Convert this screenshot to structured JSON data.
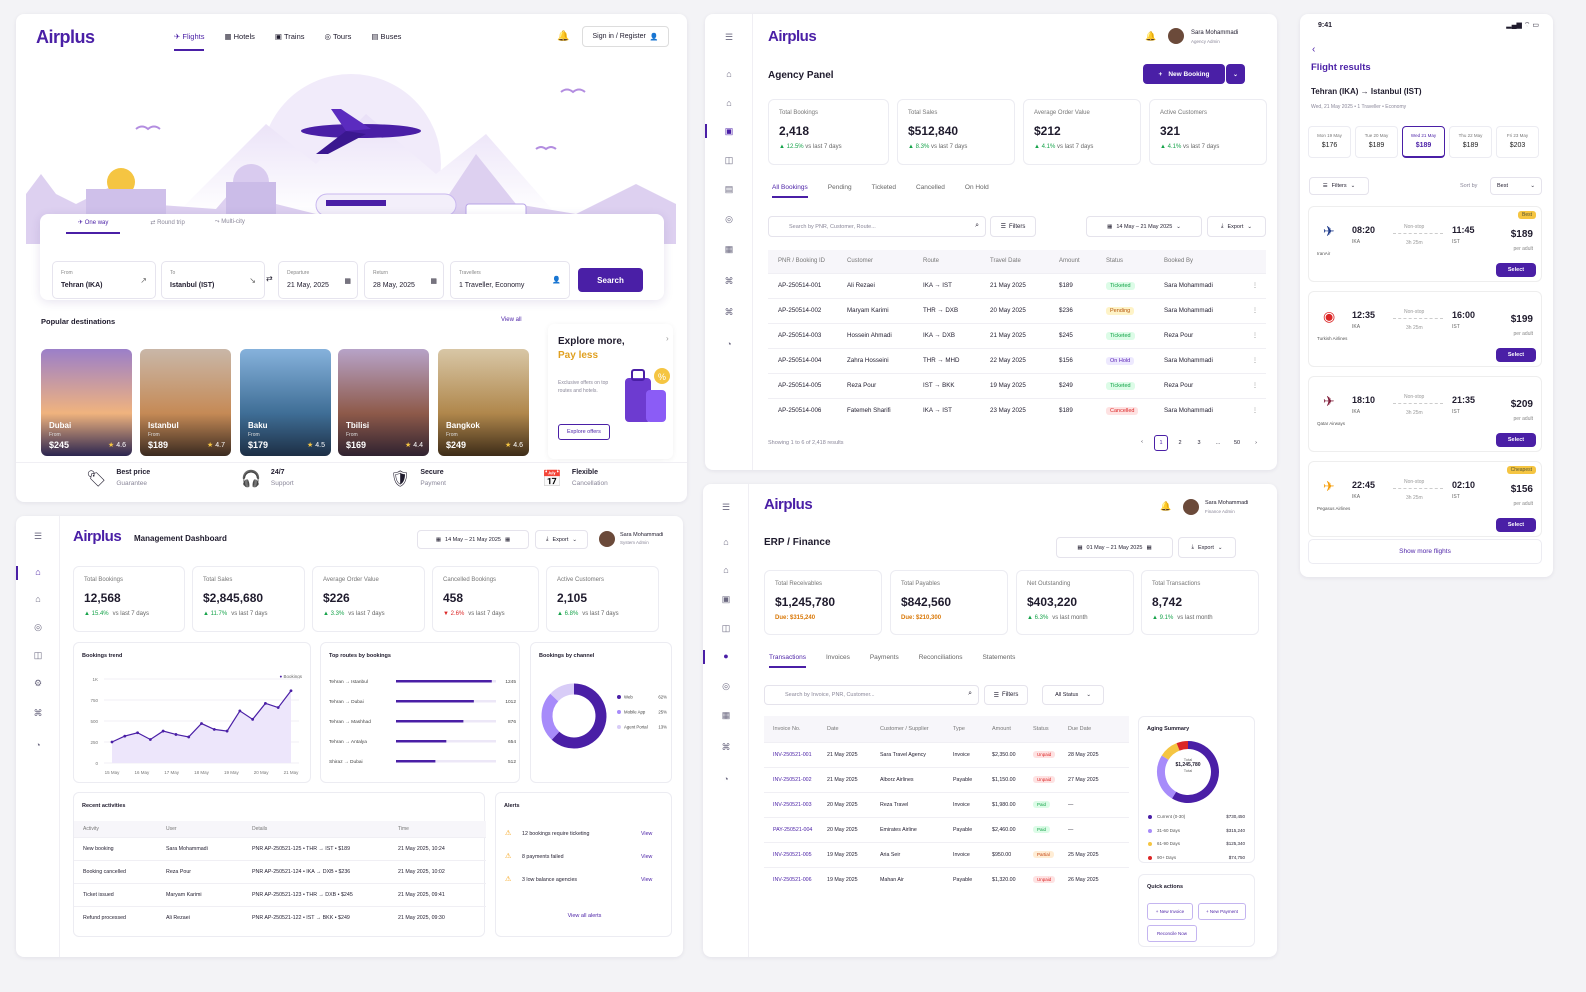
{
  "booking": {
    "logo": "Airplus",
    "nav": [
      "Flights",
      "Hotels",
      "Trains",
      "Tours",
      "Buses"
    ],
    "signin": "Sign in / Register",
    "trip_types": [
      "One way",
      "Round trip",
      "Multi-city"
    ],
    "from_label": "From",
    "from": "Tehran (IKA)",
    "to_label": "To",
    "to": "Istanbul (IST)",
    "dep_label": "Departure",
    "dep": "21 May, 2025",
    "ret_label": "Return",
    "ret": "28 May, 2025",
    "trav_label": "Travellers",
    "trav": "1 Traveller, Economy",
    "search": "Search",
    "popular": "Popular destinations",
    "view_all": "View all",
    "destinations": [
      {
        "name": "Dubai",
        "from": "From",
        "price": "$245",
        "rating": "4.6"
      },
      {
        "name": "Istanbul",
        "from": "From",
        "price": "$189",
        "rating": "4.7"
      },
      {
        "name": "Baku",
        "from": "From",
        "price": "$179",
        "rating": "4.5"
      },
      {
        "name": "Tbilisi",
        "from": "From",
        "price": "$169",
        "rating": "4.4"
      },
      {
        "name": "Bangkok",
        "from": "From",
        "price": "$249",
        "rating": "4.6"
      }
    ],
    "promo_title": "Explore more,",
    "promo_title2": "Pay less",
    "promo_text": "Exclusive offers on top routes and hotels.",
    "promo_btn": "Explore offers",
    "features": [
      {
        "t": "Best price",
        "s": "Guarantee"
      },
      {
        "t": "24/7",
        "s": "Support"
      },
      {
        "t": "Secure",
        "s": "Payment"
      },
      {
        "t": "Flexible",
        "s": "Cancellation"
      }
    ]
  },
  "agency": {
    "logo": "Airplus",
    "user": "Sara Mohammadi",
    "role": "Agency Admin",
    "title": "Agency Panel",
    "new_booking": "New Booking",
    "kpis": [
      {
        "l": "Total Bookings",
        "v": "2,418",
        "d": "12.5%",
        "s": "vs last 7 days"
      },
      {
        "l": "Total Sales",
        "v": "$512,840",
        "d": "8.3%",
        "s": "vs last 7 days"
      },
      {
        "l": "Average Order Value",
        "v": "$212",
        "d": "4.1%",
        "s": "vs last 7 days"
      },
      {
        "l": "Active Customers",
        "v": "321",
        "d": "4.1%",
        "s": "vs last 7 days"
      }
    ],
    "tabs": [
      "All Bookings",
      "Pending",
      "Ticketed",
      "Cancelled",
      "On Hold"
    ],
    "search_ph": "Search by PNR, Customer, Route...",
    "filters": "Filters",
    "date_range": "14 May – 21 May 2025",
    "export": "Export",
    "cols": [
      "PNR / Booking ID",
      "Customer",
      "Route",
      "Travel Date",
      "Amount",
      "Status",
      "Booked By"
    ],
    "rows": [
      [
        "AP-250514-001",
        "Ali Rezaei",
        "IKA → IST",
        "21 May 2025",
        "$189",
        "Ticketed",
        "Sara Mohammadi"
      ],
      [
        "AP-250514-002",
        "Maryam Karimi",
        "THR → DXB",
        "20 May 2025",
        "$236",
        "Pending",
        "Sara Mohammadi"
      ],
      [
        "AP-250514-003",
        "Hossein Ahmadi",
        "IKA → DXB",
        "21 May 2025",
        "$245",
        "Ticketed",
        "Reza Pour"
      ],
      [
        "AP-250514-004",
        "Zahra Hosseini",
        "THR → MHD",
        "22 May 2025",
        "$156",
        "On Hold",
        "Sara Mohammadi"
      ],
      [
        "AP-250514-005",
        "Reza Pour",
        "IST → BKK",
        "19 May 2025",
        "$249",
        "Ticketed",
        "Reza Pour"
      ],
      [
        "AP-250514-006",
        "Fatemeh Sharifi",
        "IKA → IST",
        "23 May 2025",
        "$189",
        "Cancelled",
        "Sara Mohammadi"
      ]
    ],
    "showing": "Showing 1 to 6 of 2,418 results",
    "pages": [
      "1",
      "2",
      "3",
      "...",
      "50"
    ]
  },
  "mobile": {
    "time": "9:41",
    "title": "Flight results",
    "from": "Tehran (IKA)",
    "to": "Istanbul (IST)",
    "sub": "Wed, 21 May 2025  •  1 Traveller  •  Economy",
    "dates": [
      {
        "d": "Mon 19 May",
        "p": "$176"
      },
      {
        "d": "Tue 20 May",
        "p": "$189"
      },
      {
        "d": "Wed 21 May",
        "p": "$189"
      },
      {
        "d": "Thu 22 May",
        "p": "$189"
      },
      {
        "d": "Fri 23 May",
        "p": "$203"
      }
    ],
    "filters": "Filters",
    "sort_label": "Sort by",
    "sort": "Best",
    "flights": [
      {
        "airline": "IranAir",
        "dep": "08:20",
        "arr": "11:45",
        "from": "IKA",
        "to": "IST",
        "stop": "Non-stop",
        "dur": "3h 25m",
        "price": "$189",
        "badge": "Best"
      },
      {
        "airline": "Turkish Airlines",
        "dep": "12:35",
        "arr": "16:00",
        "from": "IKA",
        "to": "IST",
        "stop": "Non-stop",
        "dur": "3h 25m",
        "price": "$199",
        "badge": ""
      },
      {
        "airline": "Qatar Airways",
        "dep": "18:10",
        "arr": "21:35",
        "from": "IKA",
        "to": "IST",
        "stop": "Non-stop",
        "dur": "3h 25m",
        "price": "$209",
        "badge": ""
      },
      {
        "airline": "Pegasus Airlines",
        "dep": "22:45",
        "arr": "02:10",
        "from": "IKA",
        "to": "IST",
        "stop": "Non-stop",
        "dur": "3h 25m",
        "price": "$156",
        "badge": "Cheapest"
      }
    ],
    "per_adult": "per adult",
    "select": "Select",
    "show_more": "Show more flights"
  },
  "mgmt": {
    "logo": "Airplus",
    "title": "Management Dashboard",
    "date_range": "14 May – 21 May 2025",
    "export": "Export",
    "user": "Sara Mohammadi",
    "role": "System Admin",
    "kpis": [
      {
        "l": "Total Bookings",
        "v": "12,568",
        "d": "15.4%",
        "s": "vs last 7 days",
        "dir": "up"
      },
      {
        "l": "Total Sales",
        "v": "$2,845,680",
        "d": "11.7%",
        "s": "vs last 7 days",
        "dir": "up"
      },
      {
        "l": "Average Order Value",
        "v": "$226",
        "d": "3.3%",
        "s": "vs last 7 days",
        "dir": "up"
      },
      {
        "l": "Cancelled Bookings",
        "v": "458",
        "d": "2.6%",
        "s": "vs last 7 days",
        "dir": "dn"
      },
      {
        "l": "Active Customers",
        "v": "2,105",
        "d": "6.8%",
        "s": "vs last 7 days",
        "dir": "up"
      }
    ],
    "trend_title": "Bookings trend",
    "trend_legend": "Bookings",
    "routes_title": "Top routes by bookings",
    "channel_title": "Bookings by channel",
    "activities_title": "Recent activities",
    "act_cols": [
      "Activity",
      "User",
      "Details",
      "Time"
    ],
    "activities": [
      [
        "New booking",
        "Sara Mohammadi",
        "PNR AP-250521-125 • THR → IST • $189",
        "21 May 2025, 10:24"
      ],
      [
        "Booking cancelled",
        "Reza Pour",
        "PNR AP-250521-124 • IKA → DXB • $236",
        "21 May 2025, 10:02"
      ],
      [
        "Ticket issued",
        "Maryam Karimi",
        "PNR AP-250521-123 • THR → DXB • $245",
        "21 May 2025, 09:41"
      ],
      [
        "Refund processed",
        "Ali Rezaei",
        "PNR AP-250521-122 • IST → BKK • $249",
        "21 May 2025, 09:30"
      ]
    ],
    "alerts_title": "Alerts",
    "alerts": [
      "12 bookings require ticketing",
      "8 payments failed",
      "3 low balance agencies"
    ],
    "view": "View",
    "view_all_alerts": "View all alerts"
  },
  "erp": {
    "logo": "Airplus",
    "title": "ERP / Finance",
    "date_range": "01 May – 21 May 2025",
    "export": "Export",
    "user": "Sara Mohammadi",
    "role": "Finance Admin",
    "kpis": [
      {
        "l": "Total Receivables",
        "v": "$1,245,780",
        "d": "Due: $315,240",
        "s": "",
        "kind": "due"
      },
      {
        "l": "Total Payables",
        "v": "$842,560",
        "d": "Due: $210,300",
        "s": "",
        "kind": "due"
      },
      {
        "l": "Net Outstanding",
        "v": "$403,220",
        "d": "6.3%",
        "s": "vs last month",
        "kind": "up"
      },
      {
        "l": "Total Transactions",
        "v": "8,742",
        "d": "9.1%",
        "s": "vs last month",
        "kind": "up"
      }
    ],
    "tabs": [
      "Transactions",
      "Invoices",
      "Payments",
      "Reconciliations",
      "Statements"
    ],
    "search_ph": "Search by Invoice, PNR, Customer...",
    "filters": "Filters",
    "status": "All Status",
    "cols": [
      "Invoice No.",
      "Date",
      "Customer / Supplier",
      "Type",
      "Amount",
      "Status",
      "Due Date"
    ],
    "rows": [
      [
        "INV-250521-001",
        "21 May 2025",
        "Sara Travel Agency",
        "Invoice",
        "$2,350.00",
        "Unpaid",
        "28 May 2025"
      ],
      [
        "INV-250521-002",
        "21 May 2025",
        "Alborz Airlines",
        "Payable",
        "$1,150.00",
        "Unpaid",
        "27 May 2025"
      ],
      [
        "INV-250521-003",
        "20 May 2025",
        "Reza Travel",
        "Invoice",
        "$1,980.00",
        "Paid",
        "—"
      ],
      [
        "PAY-250521-004",
        "20 May 2025",
        "Emirates Airline",
        "Payable",
        "$2,460.00",
        "Paid",
        "—"
      ],
      [
        "INV-250521-005",
        "19 May 2025",
        "Aria Seir",
        "Invoice",
        "$950.00",
        "Partial",
        "25 May 2025"
      ],
      [
        "INV-250521-006",
        "19 May 2025",
        "Mahan Air",
        "Payable",
        "$1,320.00",
        "Unpaid",
        "26 May 2025"
      ]
    ],
    "aging_title": "Aging Summary",
    "aging_center_l": "Total",
    "aging_center_v": "$1,245,780",
    "aging_center_s": "Total",
    "aging": [
      {
        "l": "Current (0-30)",
        "v": "$730,450",
        "c": "#4a1fa6"
      },
      {
        "l": "31-60 Days",
        "v": "$315,240",
        "c": "#a78bfa"
      },
      {
        "l": "61-90 Days",
        "v": "$125,340",
        "c": "#f5c542"
      },
      {
        "l": "90+ Days",
        "v": "$74,750",
        "c": "#dc2626"
      }
    ],
    "quick_title": "Quick actions",
    "quick": [
      "+ New Invoice",
      "+ New Payment",
      "Reconcile Now"
    ]
  },
  "chart_data": [
    {
      "type": "line",
      "title": "Bookings trend",
      "x": [
        "15 May",
        "16 May",
        "17 May",
        "18 May",
        "19 May",
        "20 May",
        "21 May"
      ],
      "series": [
        {
          "name": "Bookings",
          "values": [
            250,
            320,
            360,
            280,
            380,
            340,
            310,
            470,
            400,
            380,
            620,
            520,
            710,
            660,
            860
          ]
        }
      ],
      "yticks": [
        "0",
        "250",
        "500",
        "750",
        "1K"
      ],
      "ylim": [
        0,
        1000
      ]
    },
    {
      "type": "bar",
      "title": "Top routes by bookings",
      "categories": [
        "Tehran → Istanbul",
        "Tehran → Dubai",
        "Tehran → Mashhad",
        "Tehran → Antalya",
        "Shiraz → Dubai"
      ],
      "values": [
        1245,
        1012,
        876,
        654,
        512
      ]
    },
    {
      "type": "pie",
      "title": "Bookings by channel",
      "categories": [
        "Web",
        "Mobile App",
        "Agent Portal"
      ],
      "values": [
        62,
        25,
        13
      ],
      "colors": [
        "#4a1fa6",
        "#a78bfa",
        "#d8ccf7"
      ]
    }
  ],
  "colors": {
    "accent": "#4a1fa6",
    "success": "#16a34a",
    "danger": "#dc2626",
    "warning": "#f5c542"
  }
}
